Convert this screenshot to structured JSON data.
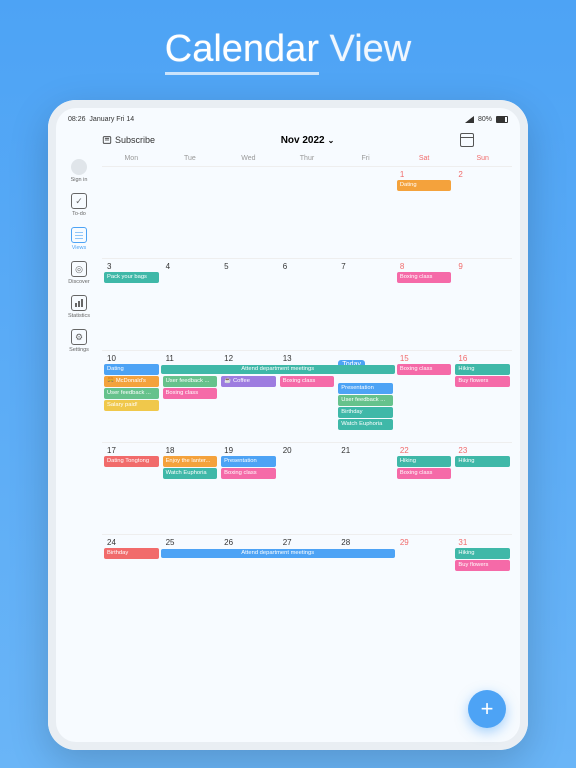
{
  "hero": {
    "first": "Calendar",
    "second": "View"
  },
  "status_bar": {
    "time": "08:26",
    "date": "January Fri 14",
    "battery": "80%"
  },
  "header": {
    "subscribe": "Subscribe",
    "month": "Nov 2022"
  },
  "sidebar": {
    "items": [
      {
        "label": "Sign in"
      },
      {
        "label": "To-do"
      },
      {
        "label": "Views"
      },
      {
        "label": "Discover"
      },
      {
        "label": "Statistics"
      },
      {
        "label": "Settings"
      }
    ]
  },
  "dow": [
    "Mon",
    "Tue",
    "Wed",
    "Thur",
    "Fri",
    "Sat",
    "Sun"
  ],
  "colors": {
    "orange": "#f4a23c",
    "pink": "#f56aa8",
    "teal": "#3fb8a8",
    "green": "#66c28c",
    "blue": "#4da3f5",
    "purple": "#9d7ce0",
    "red": "#f16b6b",
    "yellow": "#f0c84b"
  },
  "weeks": [
    {
      "days": [
        "",
        "",
        "",
        "",
        "",
        "1",
        "2"
      ],
      "events": {
        "5": [
          {
            "label": "Dating",
            "color": "orange"
          }
        ]
      },
      "spans": []
    },
    {
      "days": [
        "3",
        "4",
        "5",
        "6",
        "7",
        "8",
        "9"
      ],
      "events": {
        "0": [
          {
            "label": "Pack your bags",
            "color": "teal"
          }
        ],
        "5": [
          {
            "label": "Boxing class",
            "color": "pink"
          }
        ]
      },
      "spans": []
    },
    {
      "days": [
        "10",
        "11",
        "12",
        "13",
        "Today",
        "15",
        "16"
      ],
      "events": {
        "0": [
          {
            "label": "Dating",
            "color": "blue"
          },
          {
            "label": "🍔 McDonald's",
            "color": "orange"
          },
          {
            "label": "User feedback ...",
            "color": "green"
          },
          {
            "label": "Salary paid!",
            "color": "yellow"
          }
        ],
        "1": [
          {
            "label": "",
            "color": ""
          },
          {
            "label": "User feedback ...",
            "color": "green"
          },
          {
            "label": "Boxing class",
            "color": "pink"
          }
        ],
        "2": [
          {
            "label": "",
            "color": ""
          },
          {
            "label": "☕ Coffee",
            "color": "purple"
          }
        ],
        "3": [
          {
            "label": "",
            "color": ""
          },
          {
            "label": "Boxing class",
            "color": "pink"
          }
        ],
        "4": [
          {
            "label": "",
            "color": ""
          },
          {
            "label": "Presentation",
            "color": "blue"
          },
          {
            "label": "User feedback ...",
            "color": "green"
          },
          {
            "label": "Birthday",
            "color": "teal"
          },
          {
            "label": "Watch Euphoria",
            "color": "teal"
          }
        ],
        "5": [
          {
            "label": "Boxing class",
            "color": "pink"
          }
        ],
        "6": [
          {
            "label": "Hiking",
            "color": "teal"
          },
          {
            "label": "Buy flowers",
            "color": "pink"
          }
        ]
      },
      "spans": [
        {
          "label": "Attend department meetings",
          "color": "teal",
          "start": 1,
          "end": 4,
          "row": 0
        }
      ]
    },
    {
      "days": [
        "17",
        "18",
        "19",
        "20",
        "21",
        "22",
        "23"
      ],
      "events": {
        "0": [
          {
            "label": "Dating Tongtong",
            "color": "red"
          }
        ],
        "1": [
          {
            "label": "Enjoy the lanter...",
            "color": "orange"
          },
          {
            "label": "Watch Euphoria",
            "color": "teal"
          }
        ],
        "2": [
          {
            "label": "Presentation",
            "color": "blue"
          },
          {
            "label": "Boxing class",
            "color": "pink"
          }
        ],
        "5": [
          {
            "label": "Hiking",
            "color": "teal"
          },
          {
            "label": "Boxing class",
            "color": "pink"
          }
        ],
        "6": [
          {
            "label": "Hiking",
            "color": "teal"
          }
        ]
      },
      "spans": []
    },
    {
      "days": [
        "24",
        "25",
        "26",
        "27",
        "28",
        "29",
        "31"
      ],
      "events": {
        "0": [
          {
            "label": "Birthday",
            "color": "red"
          }
        ],
        "6": [
          {
            "label": "Hiking",
            "color": "teal"
          },
          {
            "label": "Buy flowers",
            "color": "pink"
          }
        ]
      },
      "spans": [
        {
          "label": "Attend department meetings",
          "color": "blue",
          "start": 1,
          "end": 4,
          "row": 0
        }
      ]
    }
  ]
}
